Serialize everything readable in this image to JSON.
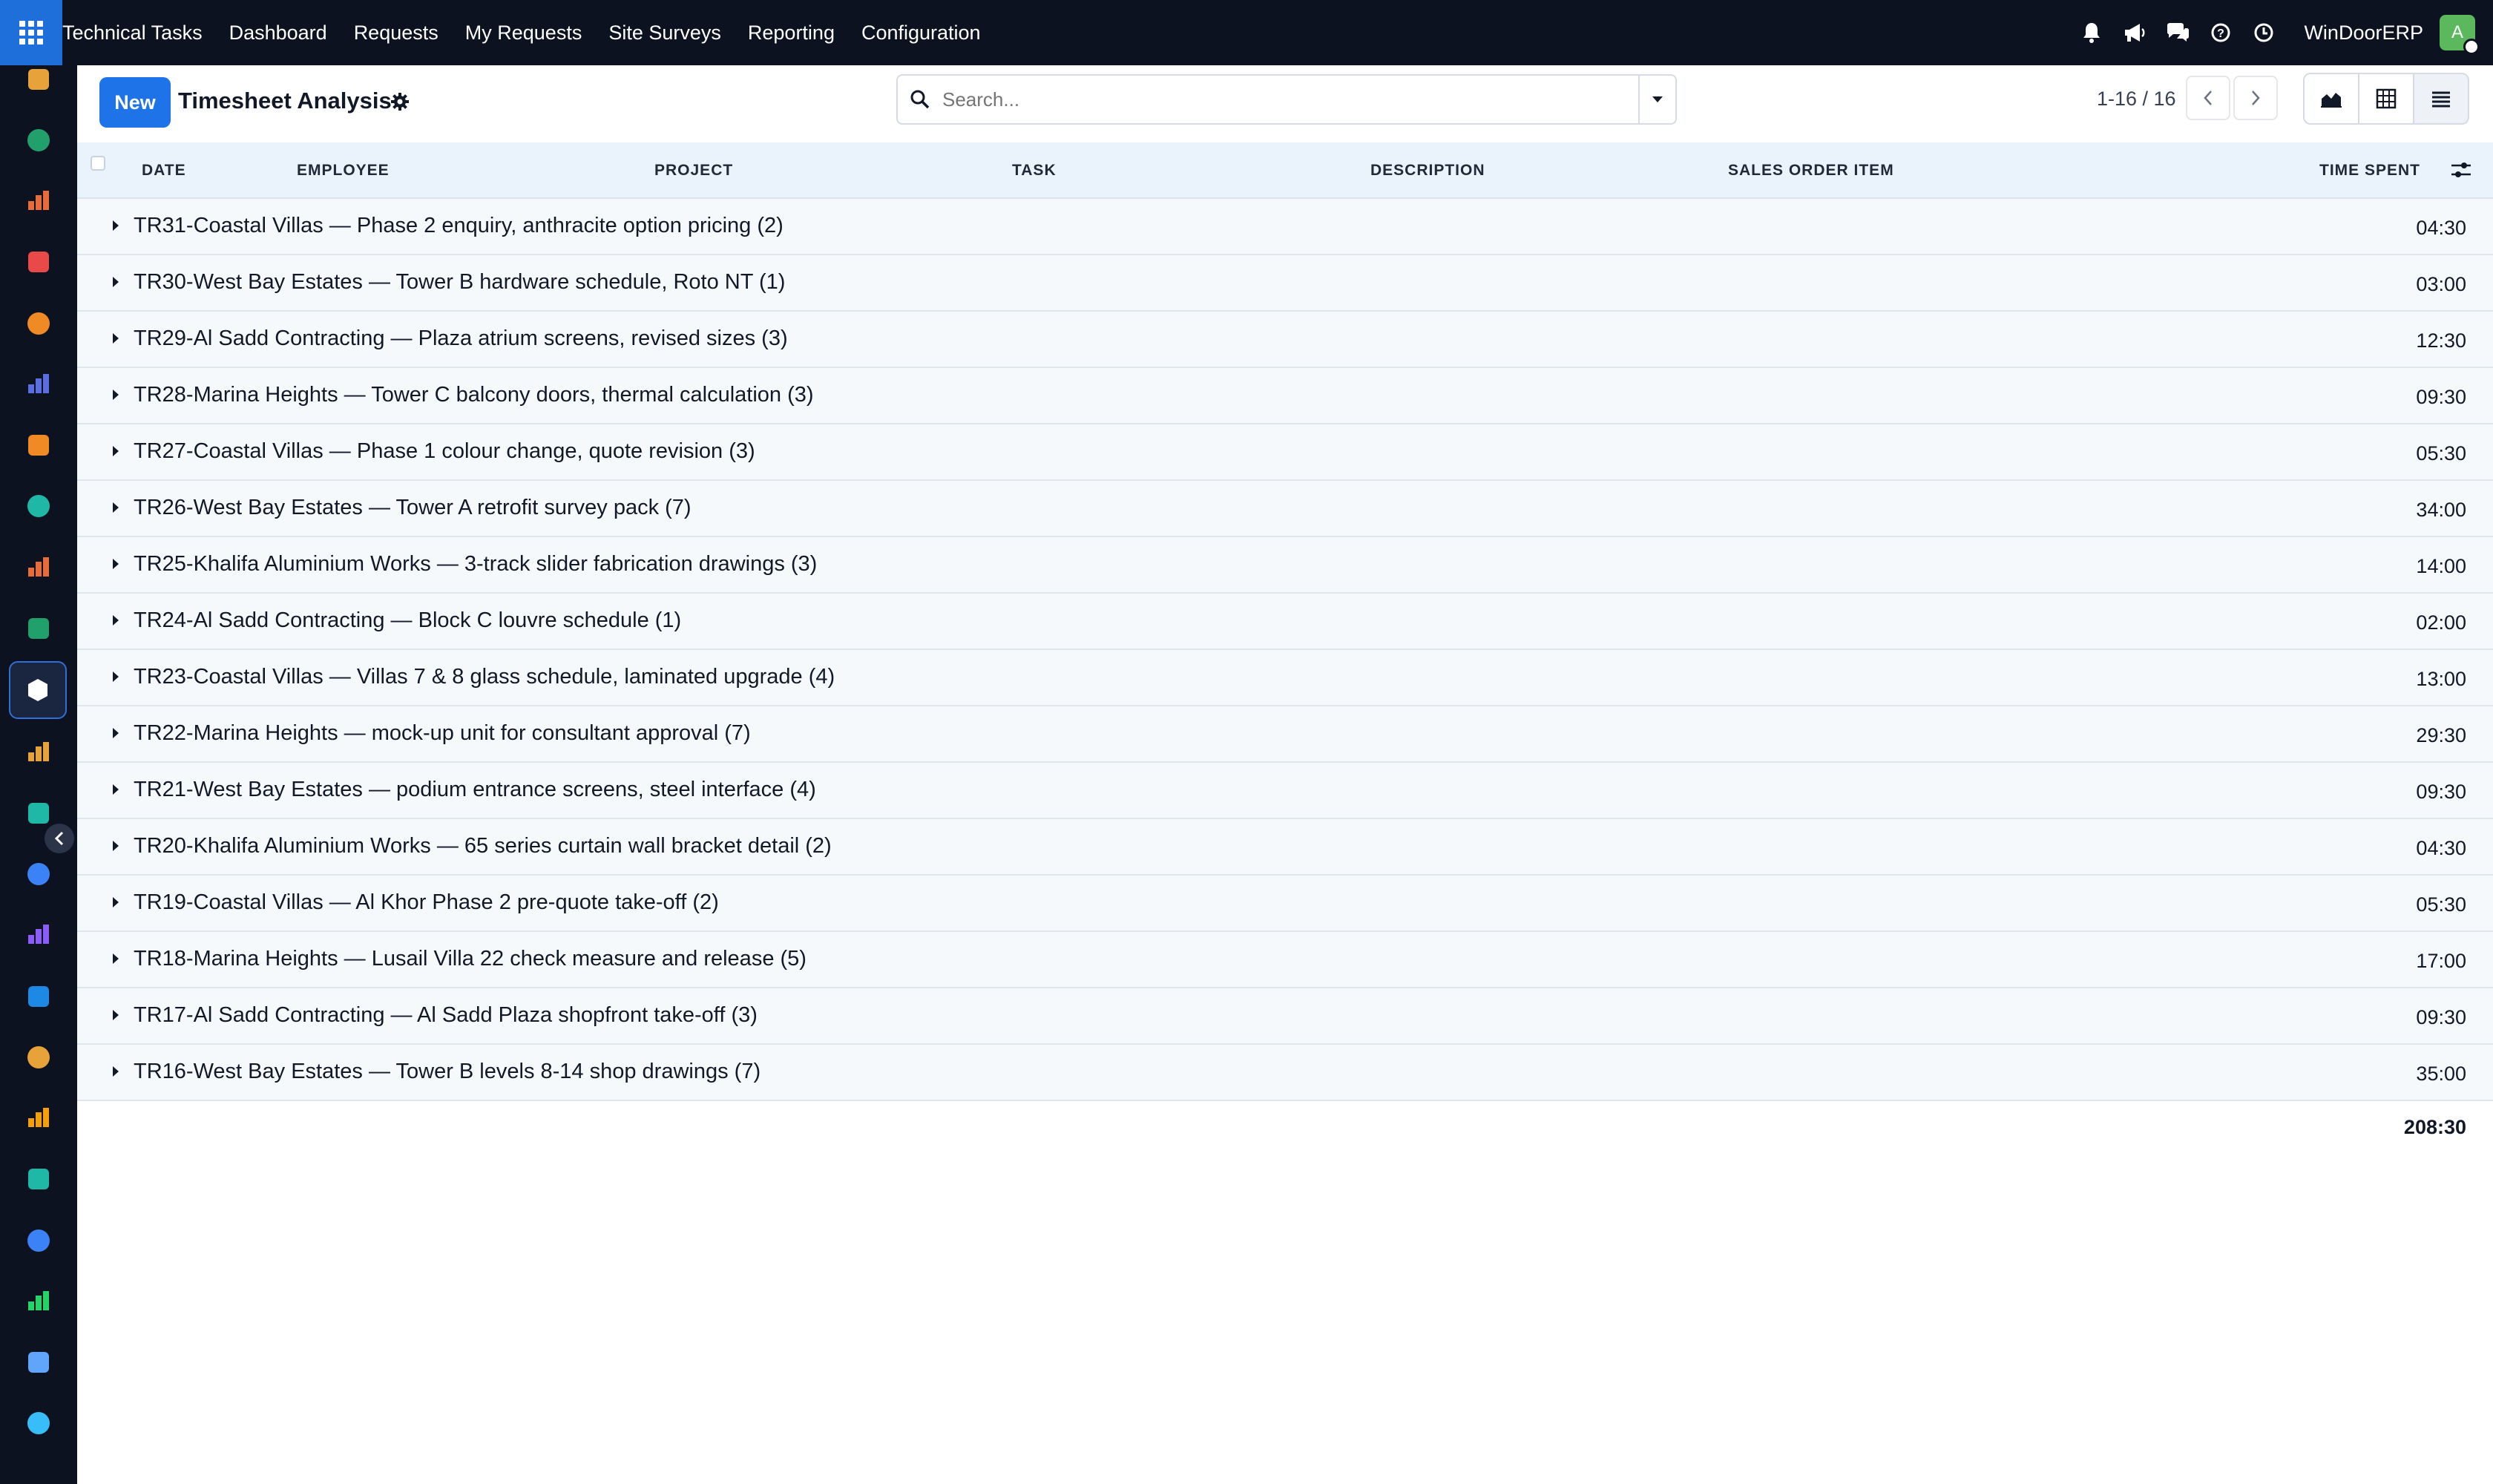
{
  "topbar": {
    "brand": "Technical Tasks",
    "menu": [
      "Dashboard",
      "Requests",
      "My Requests",
      "Site Surveys",
      "Reporting",
      "Configuration"
    ],
    "company": "WinDoorERP",
    "avatar_initial": "A",
    "icons": [
      "bell-icon",
      "megaphone-icon",
      "chat-icon",
      "help-icon",
      "clock-icon"
    ]
  },
  "sidebar": {
    "apps": [
      {
        "name": "app-icon-1",
        "color": "#e8a23a"
      },
      {
        "name": "app-icon-2",
        "color": "#22a06b"
      },
      {
        "name": "app-icon-3",
        "color": "#e86b3a"
      },
      {
        "name": "app-icon-4",
        "color": "#e84a4a"
      },
      {
        "name": "app-icon-5",
        "color": "#f08a24"
      },
      {
        "name": "app-icon-6",
        "color": "#5b6ee1"
      },
      {
        "name": "app-icon-7",
        "color": "#f08a24"
      },
      {
        "name": "app-icon-8",
        "color": "#1fb8a6"
      },
      {
        "name": "app-icon-9",
        "color": "#e86b3a"
      },
      {
        "name": "app-icon-10",
        "color": "#22a06b"
      },
      {
        "name": "app-icon-11",
        "color": "#ffffff"
      },
      {
        "name": "app-icon-12",
        "color": "#e8a23a"
      },
      {
        "name": "app-icon-13",
        "color": "#1fb8a6"
      },
      {
        "name": "app-icon-14",
        "color": "#3b82f6"
      },
      {
        "name": "app-icon-15",
        "color": "#8b5cf6"
      },
      {
        "name": "app-icon-16",
        "color": "#1e88e5"
      },
      {
        "name": "app-icon-17",
        "color": "#e8a23a"
      },
      {
        "name": "app-icon-18",
        "color": "#f59e0b"
      },
      {
        "name": "app-icon-19",
        "color": "#1fb8a6"
      },
      {
        "name": "app-icon-20",
        "color": "#3b82f6"
      },
      {
        "name": "app-icon-21",
        "color": "#25d366"
      },
      {
        "name": "app-icon-22",
        "color": "#60a5fa"
      },
      {
        "name": "app-icon-23",
        "color": "#38bdf8"
      }
    ]
  },
  "control": {
    "new_label": "New",
    "title": "Timesheet Analysis",
    "search_placeholder": "Search...",
    "pager": "1-16 / 16"
  },
  "table": {
    "columns": [
      "DATE",
      "EMPLOYEE",
      "PROJECT",
      "TASK",
      "DESCRIPTION",
      "SALES ORDER ITEM",
      "TIME SPENT"
    ],
    "groups": [
      {
        "label": "TR31-Coastal Villas — Phase 2 enquiry, anthracite option pricing (2)",
        "time": "04:30"
      },
      {
        "label": "TR30-West Bay Estates — Tower B hardware schedule, Roto NT (1)",
        "time": "03:00"
      },
      {
        "label": "TR29-Al Sadd Contracting — Plaza atrium screens, revised sizes (3)",
        "time": "12:30"
      },
      {
        "label": "TR28-Marina Heights — Tower C balcony doors, thermal calculation (3)",
        "time": "09:30"
      },
      {
        "label": "TR27-Coastal Villas — Phase 1 colour change, quote revision (3)",
        "time": "05:30"
      },
      {
        "label": "TR26-West Bay Estates — Tower A retrofit survey pack (7)",
        "time": "34:00"
      },
      {
        "label": "TR25-Khalifa Aluminium Works — 3-track slider fabrication drawings (3)",
        "time": "14:00"
      },
      {
        "label": "TR24-Al Sadd Contracting — Block C louvre schedule (1)",
        "time": "02:00"
      },
      {
        "label": "TR23-Coastal Villas — Villas 7 & 8 glass schedule, laminated upgrade (4)",
        "time": "13:00"
      },
      {
        "label": "TR22-Marina Heights — mock-up unit for consultant approval (7)",
        "time": "29:30"
      },
      {
        "label": "TR21-West Bay Estates — podium entrance screens, steel interface (4)",
        "time": "09:30"
      },
      {
        "label": "TR20-Khalifa Aluminium Works — 65 series curtain wall bracket detail (2)",
        "time": "04:30"
      },
      {
        "label": "TR19-Coastal Villas — Al Khor Phase 2 pre-quote take-off (2)",
        "time": "05:30"
      },
      {
        "label": "TR18-Marina Heights — Lusail Villa 22 check measure and release (5)",
        "time": "17:00"
      },
      {
        "label": "TR17-Al Sadd Contracting — Al Sadd Plaza shopfront take-off (3)",
        "time": "09:30"
      },
      {
        "label": "TR16-West Bay Estates — Tower B levels 8-14 shop drawings (7)",
        "time": "35:00"
      }
    ],
    "total": "208:30"
  },
  "colors": {
    "topbar_bg": "#0d1220",
    "accent": "#1e73e8",
    "header_bg": "#eaf2fb",
    "row_bg": "#f6f9fc"
  }
}
